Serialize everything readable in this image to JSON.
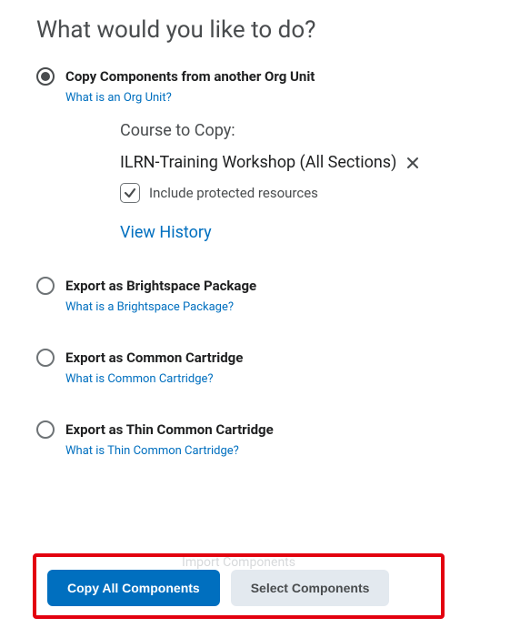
{
  "heading": "What would you like to do?",
  "options": {
    "copy": {
      "label": "Copy Components from another Org Unit",
      "help": "What is an Org Unit?",
      "selected": true,
      "course_to_copy_label": "Course to Copy:",
      "course_name": "ILRN-Training Workshop (All Sections)",
      "include_protected_label": "Include protected resources",
      "include_protected_checked": true,
      "view_history": "View History"
    },
    "export_bs": {
      "label": "Export as Brightspace Package",
      "help": "What is a Brightspace Package?"
    },
    "export_cc": {
      "label": "Export as Common Cartridge",
      "help": "What is Common Cartridge?"
    },
    "export_tcc": {
      "label": "Export as Thin Common Cartridge",
      "help": "What is Thin Common Cartridge?"
    }
  },
  "actions": {
    "faded": "Import Components",
    "primary": "Copy All Components",
    "secondary": "Select Components"
  },
  "colors": {
    "link": "#006fbf",
    "primary": "#006fbf",
    "highlight_border": "#e3000f"
  }
}
